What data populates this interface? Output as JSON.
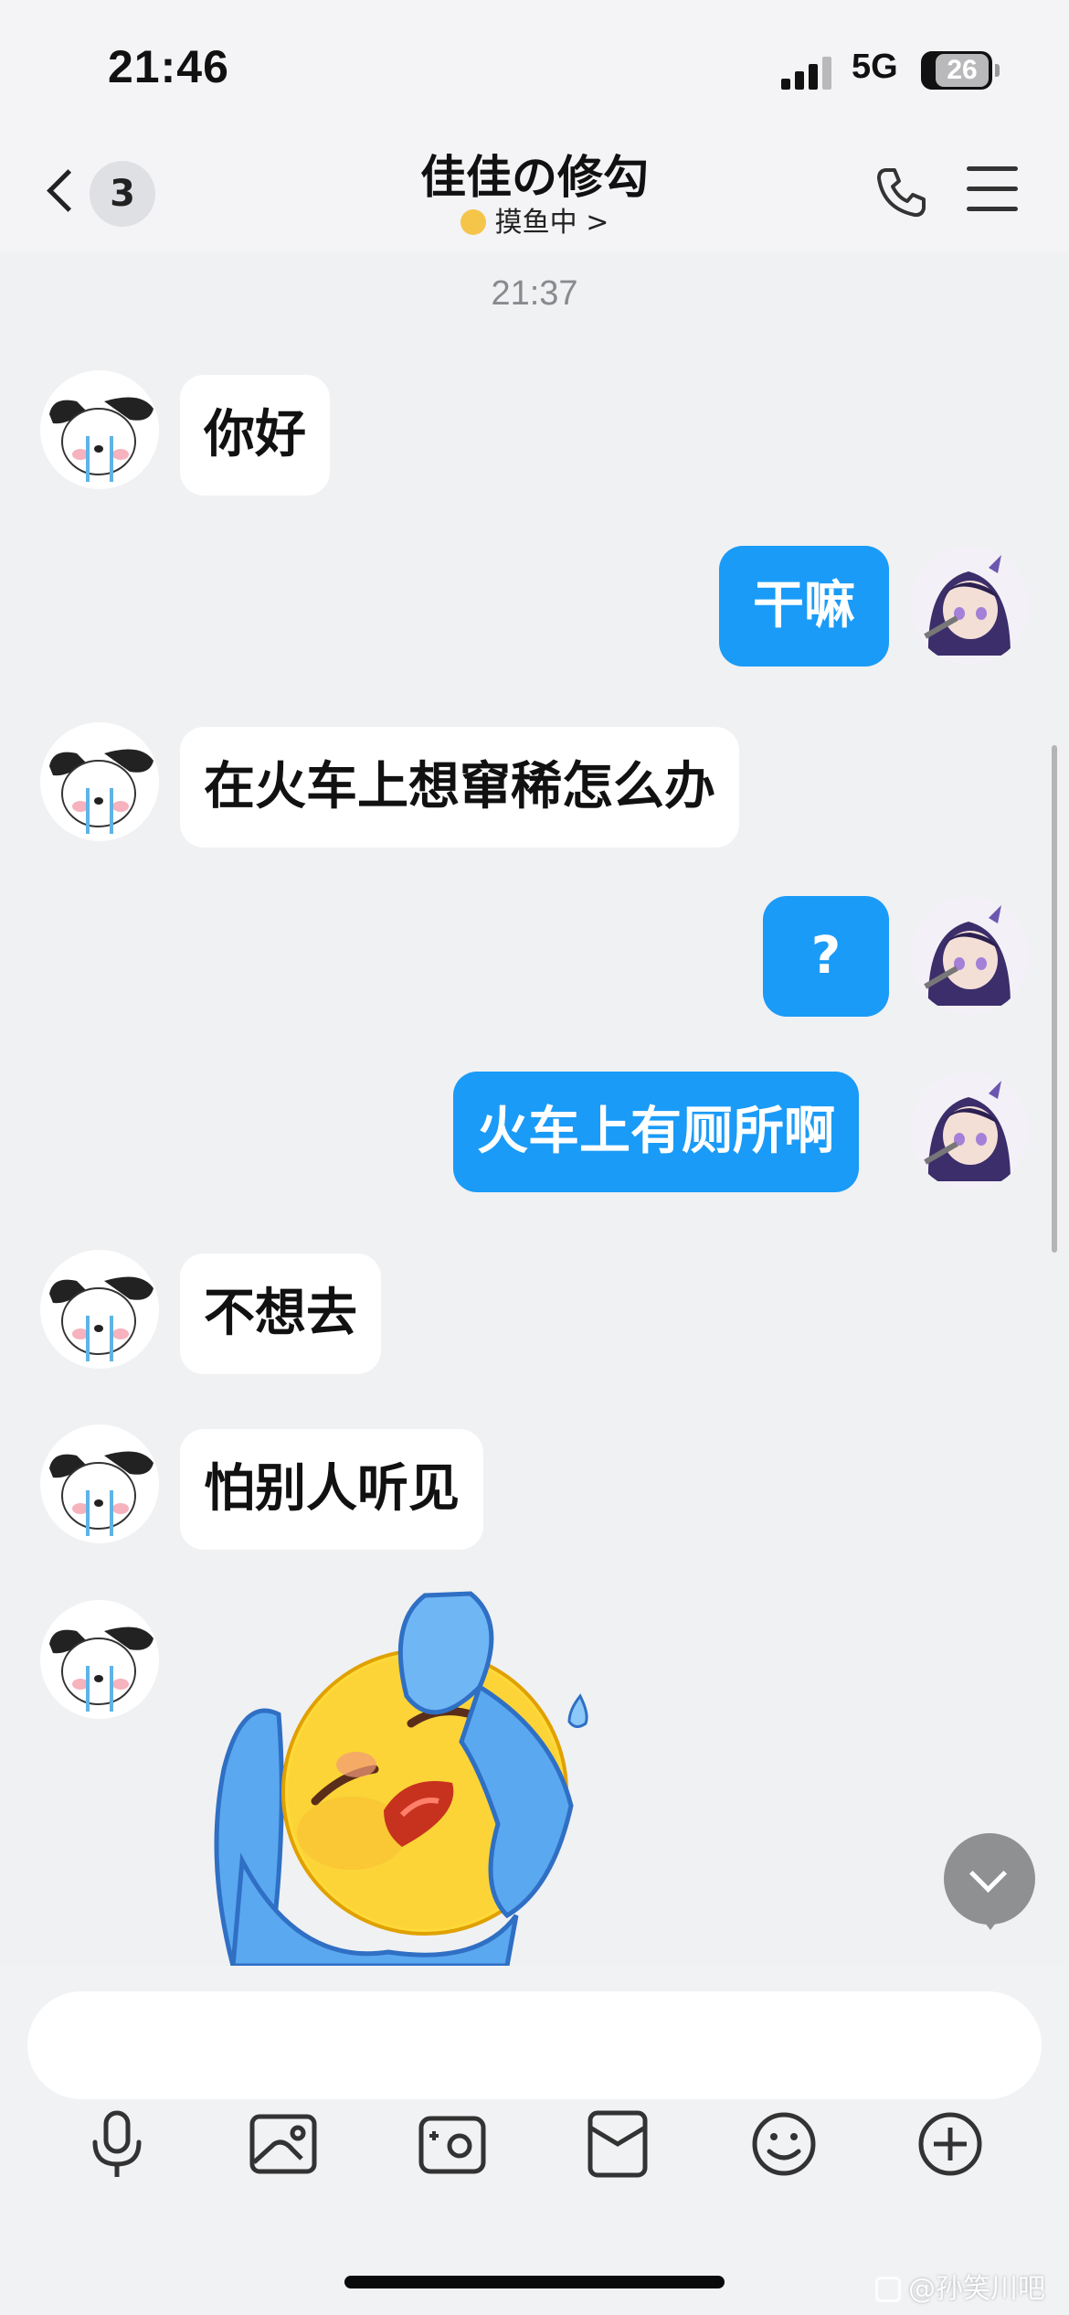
{
  "status_bar": {
    "time": "21:46",
    "network": "5G",
    "battery": "26"
  },
  "header": {
    "back_count": "3",
    "title": "佳佳の修勾",
    "status": "摸鱼中 >"
  },
  "chat": {
    "timestamp": "21:37",
    "messages": [
      {
        "from": "other",
        "text": "你好"
      },
      {
        "from": "me",
        "text": "干嘛"
      },
      {
        "from": "other",
        "text": "在火车上想窜稀怎么办"
      },
      {
        "from": "me",
        "text": "?"
      },
      {
        "from": "me",
        "text": "火车上有厕所啊"
      },
      {
        "from": "other",
        "text": "不想去"
      },
      {
        "from": "other",
        "text": "怕别人听见"
      },
      {
        "from": "other",
        "type": "sticker",
        "sticker": "crying-emoji-sticker"
      }
    ]
  },
  "input": {
    "placeholder": ""
  },
  "toolbar": {
    "icons": [
      "microphone-icon",
      "image-icon",
      "camera-icon",
      "red-packet-icon",
      "emoji-icon",
      "plus-icon"
    ]
  },
  "watermark": "@孙笑川吧",
  "colors": {
    "bubble_out": "#1a9bf7",
    "bubble_in": "#ffffff",
    "background": "#f0f1f3"
  }
}
